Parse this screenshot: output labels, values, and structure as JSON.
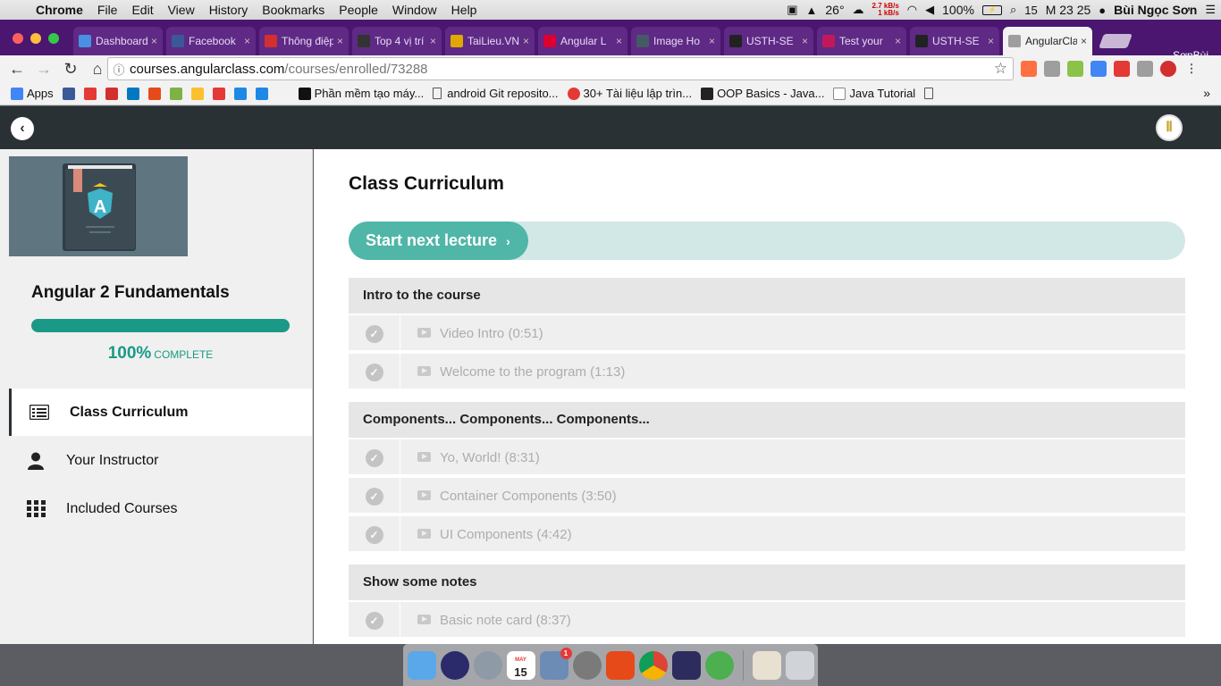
{
  "menubar": {
    "items": [
      "Chrome",
      "File",
      "Edit",
      "View",
      "History",
      "Bookmarks",
      "People",
      "Window",
      "Help"
    ],
    "weather": "26°",
    "net_up": "2.7 kB/s",
    "net_down": "1 kB/s",
    "battery": "100%",
    "clock": "M 23 25",
    "user": "Bùi Ngọc Sơn",
    "calendar_day": "15"
  },
  "tabs": [
    {
      "title": "Dashboard",
      "icon": "cube-icon",
      "color": "#4a90e2"
    },
    {
      "title": "Facebook",
      "icon": "facebook-icon",
      "color": "#3b5998"
    },
    {
      "title": "Thông điệp",
      "icon": "e-icon",
      "color": "#d32f2f"
    },
    {
      "title": "Top 4 vị trí",
      "icon": "gk-icon",
      "color": "#333333"
    },
    {
      "title": "TaiLieu.VN",
      "icon": "pencil-icon",
      "color": "#e0a800"
    },
    {
      "title": "Angular L",
      "icon": "angular-icon",
      "color": "#dd0031"
    },
    {
      "title": "Image Ho",
      "icon": "robot-icon",
      "color": "#455a64"
    },
    {
      "title": "USTH-SE",
      "icon": "github-icon",
      "color": "#222222"
    },
    {
      "title": "Test your",
      "icon": "brain-icon",
      "color": "#c2185b"
    },
    {
      "title": "USTH-SE",
      "icon": "github-icon",
      "color": "#222222"
    },
    {
      "title": "AngularClass",
      "icon": "page-icon",
      "color": "#9e9e9e"
    }
  ],
  "profile_name": "SơnBùi",
  "omnibox": {
    "host": "courses.angularclass.com",
    "path": "/courses/enrolled/73288"
  },
  "bookmarks": {
    "apps": "Apps",
    "titled": [
      "Phần mềm tạo máy...",
      "android Git reposito...",
      "30+ Tài liệu lập trìn...",
      "OOP Basics - Java...",
      "Java Tutorial"
    ]
  },
  "course": {
    "title": "Angular 2 Fundamentals",
    "progress_percent": 100,
    "progress_label": "100%",
    "complete_word": "COMPLETE",
    "cover_letter": "A"
  },
  "sidebar_nav": [
    {
      "label": "Class Curriculum",
      "icon": "list-icon",
      "active": true
    },
    {
      "label": "Your Instructor",
      "icon": "user-icon",
      "active": false
    },
    {
      "label": "Included Courses",
      "icon": "grid-icon",
      "active": false
    }
  ],
  "main": {
    "title": "Class Curriculum",
    "start_button": "Start next lecture",
    "start_chevron": "›",
    "sections": [
      {
        "title": "Intro to the course",
        "lectures": [
          "Video Intro (0:51)",
          "Welcome to the program (1:13)"
        ]
      },
      {
        "title": "Components... Components... Components...",
        "lectures": [
          "Yo, World! (8:31)",
          "Container Components (3:50)",
          "UI Components (4:42)"
        ]
      },
      {
        "title": "Show some notes",
        "lectures": [
          "Basic note card (8:37)"
        ]
      }
    ]
  },
  "dock": {
    "calendar_month": "MAY",
    "calendar_day": "15",
    "mail_badge": "1"
  },
  "colors": {
    "accent": "#1a9a86",
    "button": "#4fb6a8",
    "tabstrip": "#4a1670",
    "appbar": "#2a3135"
  }
}
